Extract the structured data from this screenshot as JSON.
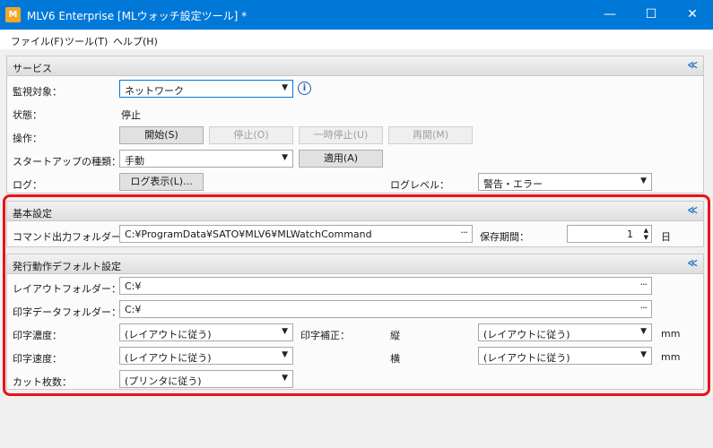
{
  "window": {
    "title": "MLV6 Enterprise [MLウォッチ設定ツール] *",
    "icon_label": "M",
    "minimize": "—",
    "maximize": "☐",
    "close": "✕",
    "accent": "#0078d7"
  },
  "menu": [
    "ファイル(F)",
    "ツール(T)",
    "ヘルプ(H)"
  ],
  "service": {
    "title": "サービス",
    "collapse": "≪",
    "monitor_label": "監視対象：",
    "monitor_value": "ネットワーク",
    "status_label": "状態：",
    "status_value": "停止",
    "operation_label": "操作：",
    "btn_start": "開始(S)",
    "btn_stop": "停止(O)",
    "btn_pause": "一時停止(U)",
    "btn_resume": "再開(M)",
    "startup_label": "スタートアップの種類：",
    "startup_value": "手動",
    "btn_apply": "適用(A)",
    "log_label": "ログ：",
    "btn_log": "ログ表示(L)...",
    "loglevel_label": "ログレベル：",
    "loglevel_value": "警告・エラー"
  },
  "basic": {
    "title": "基本設定",
    "collapse": "≪",
    "cmd_label": "コマンド出力フォルダー：",
    "cmd_value": "C:¥ProgramData¥SATO¥MLV6¥MLWatchCommand",
    "retention_label": "保存期間：",
    "retention_value": "1",
    "retention_unit": "日"
  },
  "default": {
    "title": "発行動作デフォルト設定",
    "collapse": "≪",
    "layout_label": "レイアウトフォルダー：",
    "layout_value": "C:¥",
    "printdata_label": "印字データフォルダー：",
    "printdata_value": "C:¥",
    "density_label": "印字濃度：",
    "density_value": "(レイアウトに従う)",
    "correction_label": "印字補正：",
    "vertical_label": "縦",
    "vertical_value": "(レイアウトに従う)",
    "vertical_unit": "mm",
    "speed_label": "印字速度：",
    "speed_value": "(レイアウトに従う)",
    "horizontal_label": "横",
    "horizontal_value": "(レイアウトに従う)",
    "horizontal_unit": "mm",
    "cut_label": "カット枚数：",
    "cut_value": "(プリンタに従う)"
  },
  "icons": {
    "dots": "···",
    "dropdown": "▼",
    "info": "i",
    "spin_up": "▲",
    "spin_down": "▼"
  },
  "highlight_color": "#e8121a"
}
